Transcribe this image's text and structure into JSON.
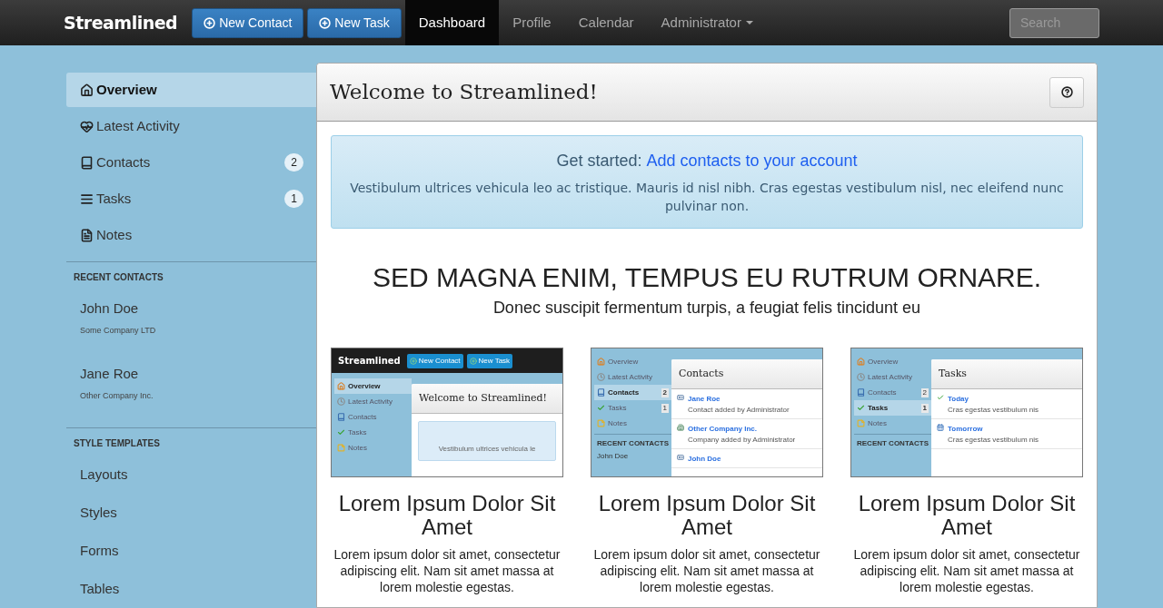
{
  "navbar": {
    "brand": "Streamlined",
    "buttons": [
      {
        "label": "New Contact"
      },
      {
        "label": "New Task"
      }
    ],
    "nav": [
      {
        "label": "Dashboard",
        "selected": true,
        "dropdown": false
      },
      {
        "label": "Profile",
        "selected": false,
        "dropdown": false
      },
      {
        "label": "Calendar",
        "selected": false,
        "dropdown": false
      },
      {
        "label": "Administrator",
        "selected": false,
        "dropdown": true
      }
    ],
    "search": {
      "placeholder": "Search"
    }
  },
  "sidebar": {
    "items": [
      {
        "label": "Overview",
        "selected": true
      },
      {
        "label": "Latest Activity",
        "selected": false
      },
      {
        "label": "Contacts",
        "selected": false,
        "badge": "2"
      },
      {
        "label": "Tasks",
        "selected": false,
        "badge": "1"
      },
      {
        "label": "Notes",
        "selected": false
      }
    ],
    "sections": [
      {
        "title": "RECENT CONTACTS",
        "kind": "contacts",
        "items": [
          {
            "name": "John Doe",
            "company": "Some Company LTD"
          },
          {
            "name": "Jane Roe",
            "company": "Other Company Inc."
          }
        ]
      },
      {
        "title": "STYLE TEMPLATES",
        "kind": "links",
        "items": [
          {
            "label": "Layouts"
          },
          {
            "label": "Styles"
          },
          {
            "label": "Forms"
          },
          {
            "label": "Tables"
          }
        ]
      }
    ]
  },
  "panel": {
    "title": "Welcome to Streamlined!",
    "alert": {
      "lead": "Get started:",
      "link": "Add contacts to your account",
      "text": "Vestibulum ultrices vehicula leo ac tristique. Mauris id nisl nibh. Cras egestas vestibulum nisl, nec eleifend nunc pulvinar non."
    },
    "heading": "SED MAGNA ENIM, TEMPUS EU RUTRUM ORNARE.",
    "subheading": "Donec suscipit fermentum turpis, a feugiat felis tincidunt eu",
    "cards": [
      {
        "title": "Lorem Ipsum Dolor Sit Amet",
        "text": "Lorem ipsum dolor sit amet, consectetur adipiscing elit. Nam sit amet massa at lorem molestie egestas.",
        "preview": {
          "brand": "Streamlined",
          "buttons": [
            "New Contact",
            "New Task"
          ],
          "sidebar": [
            {
              "label": "Overview",
              "selected": true
            },
            {
              "label": "Latest Activity",
              "selected": false
            },
            {
              "label": "Contacts",
              "selected": false
            },
            {
              "label": "Tasks",
              "selected": false
            },
            {
              "label": "Notes",
              "selected": false
            }
          ],
          "title": "Welcome to Streamlined!",
          "alert": "Vestibulum ultrices vehicula le"
        }
      },
      {
        "title": "Lorem Ipsum Dolor Sit Amet",
        "text": "Lorem ipsum dolor sit amet, consectetur adipiscing elit. Nam sit amet massa at lorem molestie egestas.",
        "preview": {
          "sidebar": [
            {
              "label": "Overview",
              "selected": false
            },
            {
              "label": "Latest Activity",
              "selected": false
            },
            {
              "label": "Contacts",
              "selected": true,
              "badge": "2"
            },
            {
              "label": "Tasks",
              "selected": false,
              "badge": "1"
            },
            {
              "label": "Notes",
              "selected": false
            }
          ],
          "section": "RECENT CONTACTS",
          "section_items": [
            "John Doe"
          ],
          "title": "Contacts",
          "entries": [
            {
              "kind": "contact",
              "title": "Jane Roe",
              "text": "Contact added by Administrator"
            },
            {
              "kind": "company",
              "title": "Other Company Inc.",
              "text": "Company added by Administrator"
            },
            {
              "kind": "contact",
              "title": "John Doe"
            }
          ]
        }
      },
      {
        "title": "Lorem Ipsum Dolor Sit Amet",
        "text": "Lorem ipsum dolor sit amet, consectetur adipiscing elit. Nam sit amet massa at lorem molestie egestas.",
        "preview": {
          "sidebar": [
            {
              "label": "Overview",
              "selected": false
            },
            {
              "label": "Latest Activity",
              "selected": false
            },
            {
              "label": "Contacts",
              "selected": false,
              "badge": "2"
            },
            {
              "label": "Tasks",
              "selected": true,
              "badge": "1"
            },
            {
              "label": "Notes",
              "selected": false
            }
          ],
          "section": "RECENT CONTACTS",
          "title": "Tasks",
          "entries": [
            {
              "kind": "done",
              "title": "Today",
              "text": "Cras egestas vestibulum nis"
            },
            {
              "kind": "scheduled",
              "title": "Tomorrow",
              "text": "Cras egestas vestibulum nis"
            }
          ]
        }
      }
    ]
  }
}
